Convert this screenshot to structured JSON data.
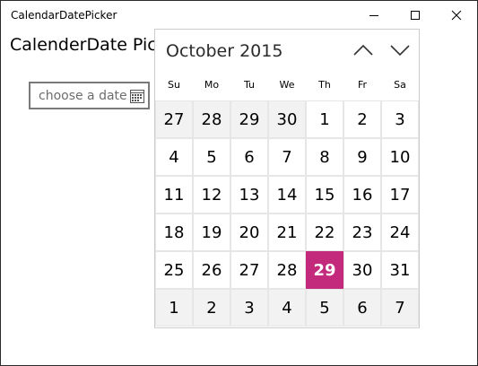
{
  "window": {
    "title": "CalendarDatePicker",
    "controls": [
      "minimize-icon",
      "maximize-icon",
      "close-icon"
    ]
  },
  "page": {
    "title": "CalenderDate Pick"
  },
  "date_picker": {
    "placeholder": "choose a date",
    "icon": "calendar-icon"
  },
  "calendar": {
    "month_label": "October 2015",
    "prev_icon": "chevron-up-icon",
    "next_icon": "chevron-down-icon",
    "days_of_week": [
      "Su",
      "Mo",
      "Tu",
      "We",
      "Th",
      "Fr",
      "Sa"
    ],
    "weeks": [
      [
        {
          "d": "27",
          "out": true
        },
        {
          "d": "28",
          "out": true
        },
        {
          "d": "29",
          "out": true
        },
        {
          "d": "30",
          "out": true
        },
        {
          "d": "1"
        },
        {
          "d": "2"
        },
        {
          "d": "3"
        }
      ],
      [
        {
          "d": "4"
        },
        {
          "d": "5"
        },
        {
          "d": "6"
        },
        {
          "d": "7"
        },
        {
          "d": "8"
        },
        {
          "d": "9"
        },
        {
          "d": "10"
        }
      ],
      [
        {
          "d": "11"
        },
        {
          "d": "12"
        },
        {
          "d": "13"
        },
        {
          "d": "14"
        },
        {
          "d": "15"
        },
        {
          "d": "16"
        },
        {
          "d": "17"
        }
      ],
      [
        {
          "d": "18"
        },
        {
          "d": "19"
        },
        {
          "d": "20"
        },
        {
          "d": "21"
        },
        {
          "d": "22"
        },
        {
          "d": "23"
        },
        {
          "d": "24"
        }
      ],
      [
        {
          "d": "25"
        },
        {
          "d": "26"
        },
        {
          "d": "27"
        },
        {
          "d": "28"
        },
        {
          "d": "29",
          "today": true
        },
        {
          "d": "30"
        },
        {
          "d": "31"
        }
      ],
      [
        {
          "d": "1",
          "out": true
        },
        {
          "d": "2",
          "out": true
        },
        {
          "d": "3",
          "out": true
        },
        {
          "d": "4",
          "out": true
        },
        {
          "d": "5",
          "out": true
        },
        {
          "d": "6",
          "out": true
        },
        {
          "d": "7",
          "out": true
        }
      ]
    ],
    "accent_color": "#c42a7c"
  }
}
